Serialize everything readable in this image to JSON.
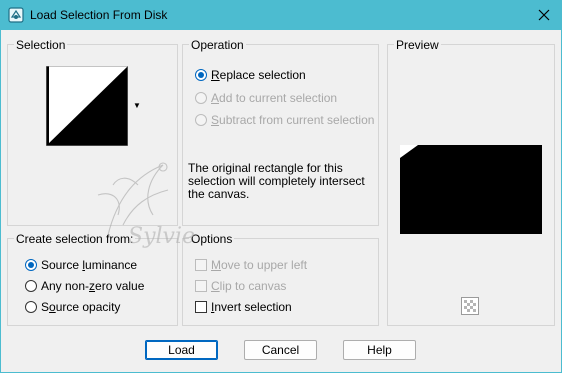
{
  "window": {
    "title": "Load Selection From Disk",
    "titlebar_color": "#4cbcd0"
  },
  "selection": {
    "label": "Selection"
  },
  "operation": {
    "label": "Operation",
    "options": [
      {
        "pre": "",
        "key": "R",
        "post": "eplace selection",
        "checked": true,
        "disabled": false
      },
      {
        "pre": "",
        "key": "A",
        "post": "dd to current selection",
        "checked": false,
        "disabled": true
      },
      {
        "pre": "",
        "key": "S",
        "post": "ubtract from current selection",
        "checked": false,
        "disabled": true
      }
    ],
    "info_text": "The original rectangle for this selection will completely intersect the canvas."
  },
  "preview": {
    "label": "Preview"
  },
  "create_from": {
    "label": "Create selection from:",
    "options": [
      {
        "pre": "Source ",
        "key": "l",
        "post": "uminance",
        "checked": true
      },
      {
        "pre": "Any non-",
        "key": "z",
        "post": "ero value",
        "checked": false
      },
      {
        "pre": "S",
        "key": "o",
        "post": "urce opacity",
        "checked": false
      }
    ]
  },
  "options_group": {
    "label": "Options",
    "items": [
      {
        "pre": "",
        "key": "M",
        "post": "ove to upper left",
        "checked": false,
        "disabled": true
      },
      {
        "pre": "",
        "key": "C",
        "post": "lip to canvas",
        "checked": false,
        "disabled": true
      },
      {
        "pre": "",
        "key": "I",
        "post": "nvert selection",
        "checked": false,
        "disabled": false
      }
    ]
  },
  "buttons": {
    "load": "Load",
    "cancel": "Cancel",
    "help": "Help"
  },
  "watermark": {
    "text": "Sylvie"
  }
}
